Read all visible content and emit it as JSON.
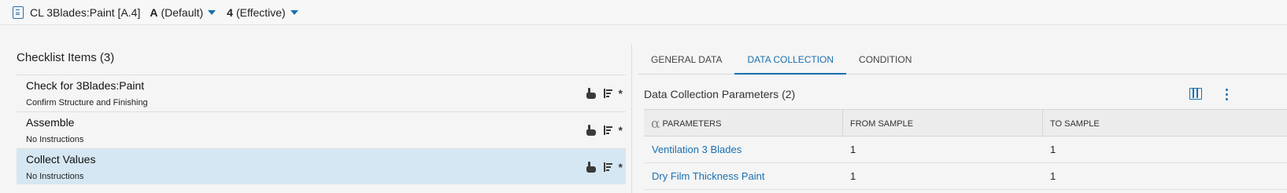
{
  "header": {
    "title": "CL 3Blades:Paint [A.4]",
    "revision1": {
      "value": "A",
      "desc": "(Default)"
    },
    "revision2": {
      "value": "4",
      "desc": "(Effective)"
    }
  },
  "checklist": {
    "title": "Checklist Items (3)",
    "items": [
      {
        "name": "Check for 3Blades:Paint",
        "desc": "Confirm Structure and Finishing",
        "selected": false
      },
      {
        "name": "Assemble",
        "desc": "No Instructions",
        "selected": false
      },
      {
        "name": "Collect Values",
        "desc": "No Instructions",
        "selected": true
      }
    ],
    "item_icons": [
      "hand-icon",
      "sort-icon",
      "asterisk-icon"
    ]
  },
  "tabs": [
    {
      "label": "GENERAL DATA",
      "active": false
    },
    {
      "label": "DATA COLLECTION",
      "active": true
    },
    {
      "label": "CONDITION",
      "active": false
    }
  ],
  "data_collection": {
    "title": "Data Collection Parameters (2)",
    "columns": [
      "PARAMETERS",
      "FROM SAMPLE",
      "TO SAMPLE"
    ],
    "rows": [
      {
        "parameter": "Ventilation 3 Blades",
        "from": "1",
        "to": "1"
      },
      {
        "parameter": "Dry Film Thickness Paint",
        "from": "1",
        "to": "1"
      }
    ]
  },
  "colors": {
    "accent": "#1a6fb0",
    "selected_row": "#d5e7f2"
  }
}
